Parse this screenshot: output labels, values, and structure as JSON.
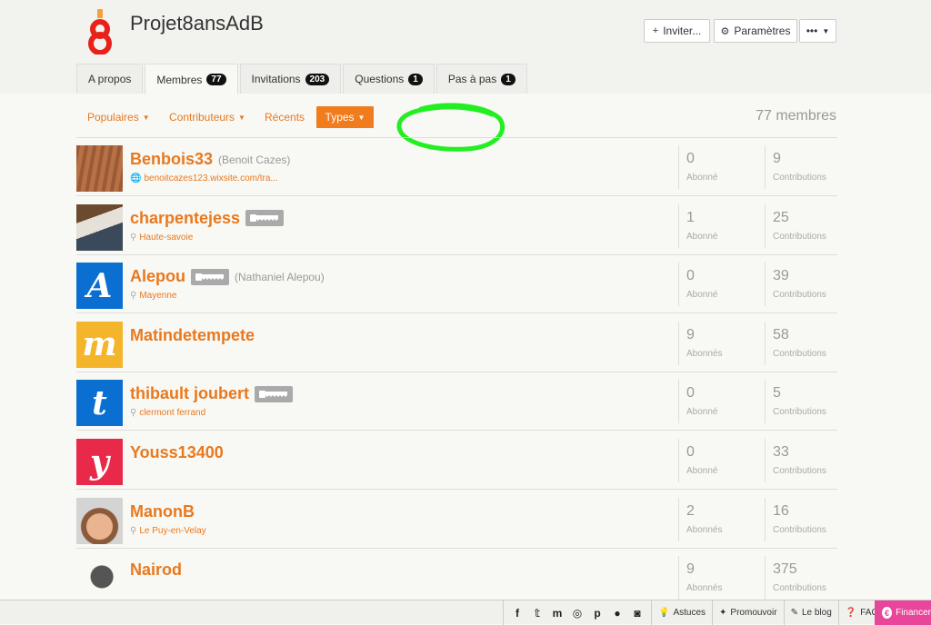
{
  "project": {
    "title": "Projet8ansAdB"
  },
  "header_buttons": {
    "invite": "Inviter...",
    "settings": "Paramètres",
    "more": "•••"
  },
  "tabs": [
    {
      "label": "A propos",
      "count": null
    },
    {
      "label": "Membres",
      "count": "77"
    },
    {
      "label": "Invitations",
      "count": "203"
    },
    {
      "label": "Questions",
      "count": "1"
    },
    {
      "label": "Pas à pas",
      "count": "1"
    }
  ],
  "filters": {
    "popular": "Populaires",
    "contributors": "Contributeurs",
    "recent": "Récents",
    "types": "Types"
  },
  "member_count": "77 membres",
  "members": [
    {
      "username": "Benbois33",
      "fullname": "(Benoit Cazes)",
      "subtitle": "benoitcazes123.wixsite.com/tra...",
      "followers": "0",
      "followers_label": "Abonné",
      "contributions": "9",
      "contributions_label": "Contributions"
    },
    {
      "username": "charpentejess",
      "fullname": "",
      "subtitle": "Haute-savoie",
      "followers": "1",
      "followers_label": "Abonné",
      "contributions": "25",
      "contributions_label": "Contributions"
    },
    {
      "username": "Alepou",
      "fullname": "(Nathaniel Alepou)",
      "subtitle": "Mayenne",
      "followers": "0",
      "followers_label": "Abonné",
      "contributions": "39",
      "contributions_label": "Contributions",
      "avatar_letter": "A"
    },
    {
      "username": "Matindetempete",
      "fullname": "",
      "subtitle": "",
      "followers": "9",
      "followers_label": "Abonnés",
      "contributions": "58",
      "contributions_label": "Contributions",
      "avatar_letter": "m"
    },
    {
      "username": "thibault joubert",
      "fullname": "",
      "subtitle": "clermont ferrand",
      "followers": "0",
      "followers_label": "Abonné",
      "contributions": "5",
      "contributions_label": "Contributions",
      "avatar_letter": "t"
    },
    {
      "username": "Youss13400",
      "fullname": "",
      "subtitle": "",
      "followers": "0",
      "followers_label": "Abonné",
      "contributions": "33",
      "contributions_label": "Contributions",
      "avatar_letter": "y"
    },
    {
      "username": "ManonB",
      "fullname": "",
      "subtitle": "Le Puy-en-Velay",
      "followers": "2",
      "followers_label": "Abonnés",
      "contributions": "16",
      "contributions_label": "Contributions"
    },
    {
      "username": "Nairod",
      "fullname": "",
      "subtitle": "",
      "followers": "9",
      "followers_label": "Abonnés",
      "contributions": "375",
      "contributions_label": "Contributions"
    }
  ],
  "footer": {
    "tips": "Astuces",
    "promote": "Promouvoir",
    "blog": "Le blog",
    "faq": "FAQ",
    "fund": "Financer"
  },
  "colors": {
    "accent": "#e8791f",
    "avatar_blue": "#0a6fd0",
    "avatar_yellow": "#f5b52b",
    "avatar_red": "#e8294a",
    "financer": "#e8469a"
  }
}
